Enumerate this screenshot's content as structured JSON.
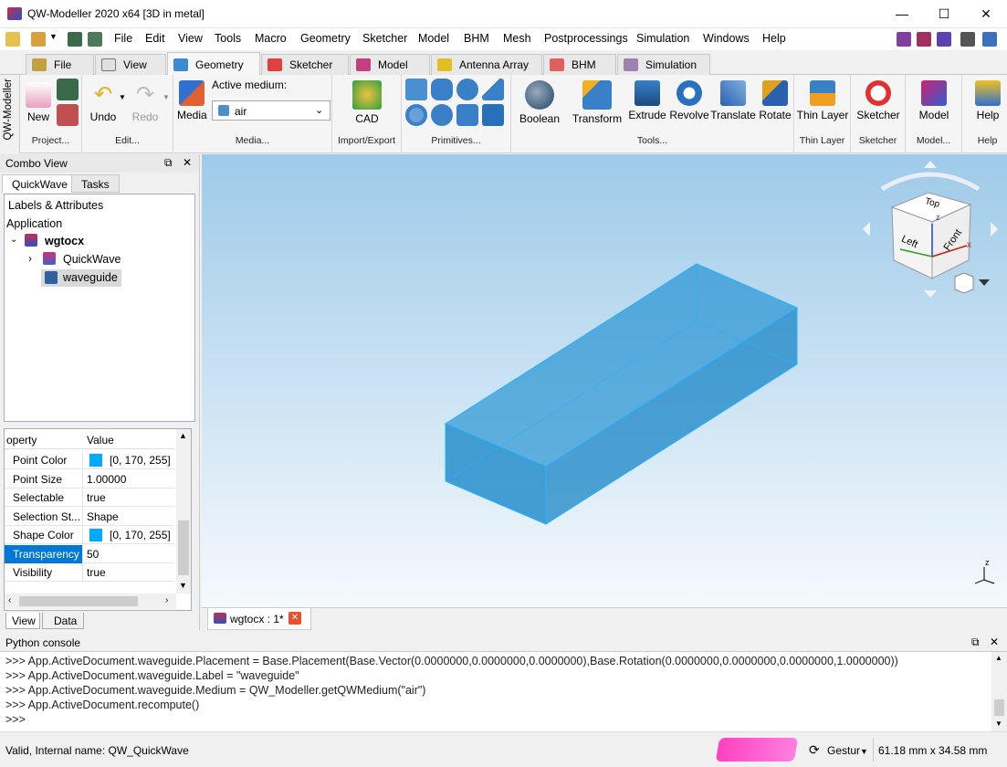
{
  "window": {
    "title": "QW-Modeller 2020 x64 [3D in metal]"
  },
  "menu": [
    "File",
    "Edit",
    "View",
    "Tools",
    "Macro",
    "Geometry",
    "Sketcher",
    "Model",
    "BHM",
    "Mesh",
    "Postprocessings",
    "Simulation",
    "Windows",
    "Help"
  ],
  "workbench_tabs": [
    "File",
    "View",
    "Geometry",
    "Sketcher",
    "Model",
    "Antenna Array",
    "BHM",
    "Simulation"
  ],
  "side_tab": "QW-Modeller",
  "ribbon": {
    "new": "New",
    "project": "Project...",
    "undo": "Undo",
    "redo": "Redo",
    "edit": "Edit...",
    "media_btn": "Media",
    "active_medium_label": "Active medium:",
    "active_medium_value": "air",
    "media_group": "Media...",
    "cad": "CAD",
    "import_export": "Import/Export",
    "primitives": "Primitives...",
    "tools": [
      "Boolean",
      "Transform",
      "Extrude",
      "Revolve",
      "Translate",
      "Rotate"
    ],
    "tools_group": "Tools...",
    "thin_layer": "Thin Layer",
    "thin_layer_group": "Thin Layer",
    "sketcher": "Sketcher",
    "sketcher_group": "Sketcher",
    "model": "Model",
    "model_group": "Model...",
    "help": "Help",
    "help_group": "Help"
  },
  "combo": {
    "title": "Combo View",
    "tabs": [
      "QuickWave",
      "Tasks"
    ],
    "labels_header": "Labels & Attributes",
    "application": "Application",
    "doc": "wgtocx",
    "children": [
      "QuickWave",
      "waveguide"
    ],
    "prop_header": [
      "operty",
      "Value"
    ],
    "properties": [
      {
        "k": "Point Color",
        "v": "[0, 170, 255]",
        "color": "#00aaff"
      },
      {
        "k": "Point Size",
        "v": "1.00000"
      },
      {
        "k": "Selectable",
        "v": "true"
      },
      {
        "k": "Selection St...",
        "v": "Shape"
      },
      {
        "k": "Shape Color",
        "v": "[0, 170, 255]",
        "color": "#00aaff"
      },
      {
        "k": "Transparency",
        "v": "50",
        "selected": true
      },
      {
        "k": "Visibility",
        "v": "true"
      }
    ],
    "bottom_tabs": [
      "View",
      "Data"
    ]
  },
  "navcube": {
    "top": "Top",
    "left": "Left",
    "front": "Front",
    "x": "x",
    "z": "z"
  },
  "doc_tab": "wgtocx : 1*",
  "console": {
    "title": "Python console",
    "lines": [
      ">>> App.ActiveDocument.waveguide.Placement = Base.Placement(Base.Vector(0.0000000,0.0000000,0.0000000),Base.Rotation(0.0000000,0.0000000,0.0000000,1.0000000))",
      ">>> App.ActiveDocument.waveguide.Label = \"waveguide\"",
      ">>> App.ActiveDocument.waveguide.Medium = QW_Modeller.getQWMedium(\"air\")",
      ">>> App.ActiveDocument.recompute()",
      ">>>"
    ]
  },
  "status": {
    "left": "Valid, Internal name: QW_QuickWave",
    "nav": "Gestur",
    "dims": "61.18 mm x 34.58 mm"
  },
  "colors": {
    "shape": "#00aaff",
    "viewport_top": "#9ecae9"
  }
}
